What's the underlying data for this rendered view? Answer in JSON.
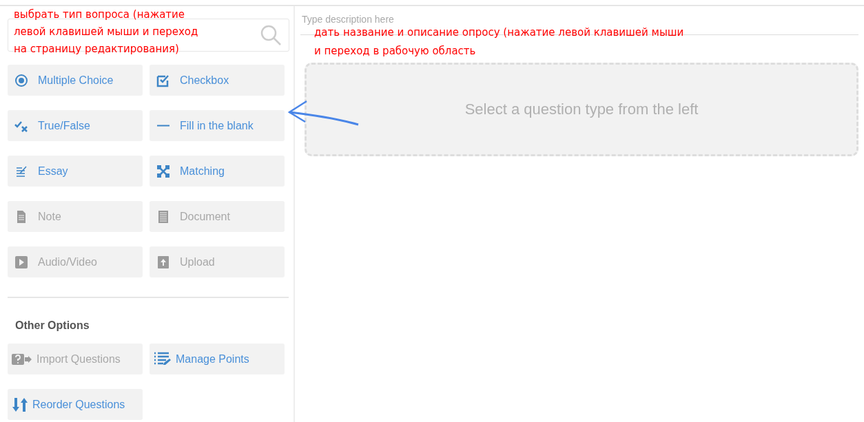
{
  "question_types": [
    {
      "label": "Multiple Choice",
      "kind": "radio",
      "disabled": false
    },
    {
      "label": "Checkbox",
      "kind": "checkbox",
      "disabled": false
    },
    {
      "label": "True/False",
      "kind": "truefalse",
      "disabled": false
    },
    {
      "label": "Fill in the blank",
      "kind": "blank",
      "disabled": false
    },
    {
      "label": "Essay",
      "kind": "essay",
      "disabled": false
    },
    {
      "label": "Matching",
      "kind": "matching",
      "disabled": false
    },
    {
      "label": "Note",
      "kind": "note",
      "disabled": true
    },
    {
      "label": "Document",
      "kind": "document",
      "disabled": true
    },
    {
      "label": "Audio/Video",
      "kind": "media",
      "disabled": true
    },
    {
      "label": "Upload",
      "kind": "upload",
      "disabled": true
    }
  ],
  "other_options": {
    "title": "Other Options",
    "items": [
      {
        "label": "Import Questions",
        "kind": "import",
        "disabled": true
      },
      {
        "label": "Manage Points",
        "kind": "points",
        "disabled": false
      },
      {
        "label": "Reorder Questions",
        "kind": "reorder",
        "disabled": false
      }
    ]
  },
  "description": {
    "placeholder": "Type description here"
  },
  "drop_zone": {
    "text": "Select a question type from the left"
  },
  "annotations": [
    {
      "lines": [
        "выбрать тип вопроса (нажатие",
        "левой клавишей мыши и переход",
        "на страницу редактирования)"
      ]
    },
    {
      "lines": [
        "дать название и описание опросу (нажатие левой клавишей мыши",
        "и переход в рабочую область"
      ]
    }
  ]
}
